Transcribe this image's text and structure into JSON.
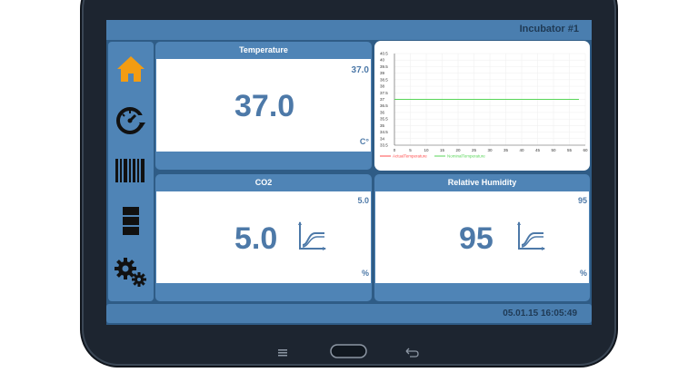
{
  "app": {
    "title": "Incubator #1",
    "datetime": "05.01.15 16:05:49"
  },
  "sidebar": {
    "items": [
      {
        "icon": "home-icon",
        "color": "#f39c12"
      },
      {
        "icon": "dial-refresh-icon"
      },
      {
        "icon": "barcode-icon"
      },
      {
        "icon": "schedule-icon"
      },
      {
        "icon": "settings-gears-icon"
      }
    ]
  },
  "panels": {
    "temperature": {
      "title": "Temperature",
      "value": "37.0",
      "setpoint": "37.0",
      "unit": "C°"
    },
    "co2": {
      "title": "CO2",
      "value": "5.0",
      "setpoint": "5.0",
      "unit": "%"
    },
    "humidity": {
      "title": "Relative Humidity",
      "value": "95",
      "setpoint": "95",
      "unit": "%"
    }
  },
  "chart_data": {
    "type": "line",
    "x_ticks": [
      "0",
      "5",
      "10",
      "15",
      "20",
      "25",
      "30",
      "35",
      "40",
      "45",
      "50",
      "55",
      "60"
    ],
    "y_ticks": [
      "33.5",
      "34",
      "34.5",
      "35",
      "35.5",
      "36",
      "36.5",
      "37",
      "37.5",
      "38",
      "38.5",
      "39",
      "39.5",
      "40",
      "40.5"
    ],
    "xlim": [
      0,
      60
    ],
    "ylim": [
      33.5,
      40.5
    ],
    "series": [
      {
        "name": "ActualTemperature",
        "color": "#ff4d4d",
        "x": [
          0,
          58
        ],
        "y": [
          37,
          37
        ]
      },
      {
        "name": "NominalTemperature",
        "color": "#59d659",
        "x": [
          0,
          58
        ],
        "y": [
          37,
          37
        ]
      }
    ]
  }
}
